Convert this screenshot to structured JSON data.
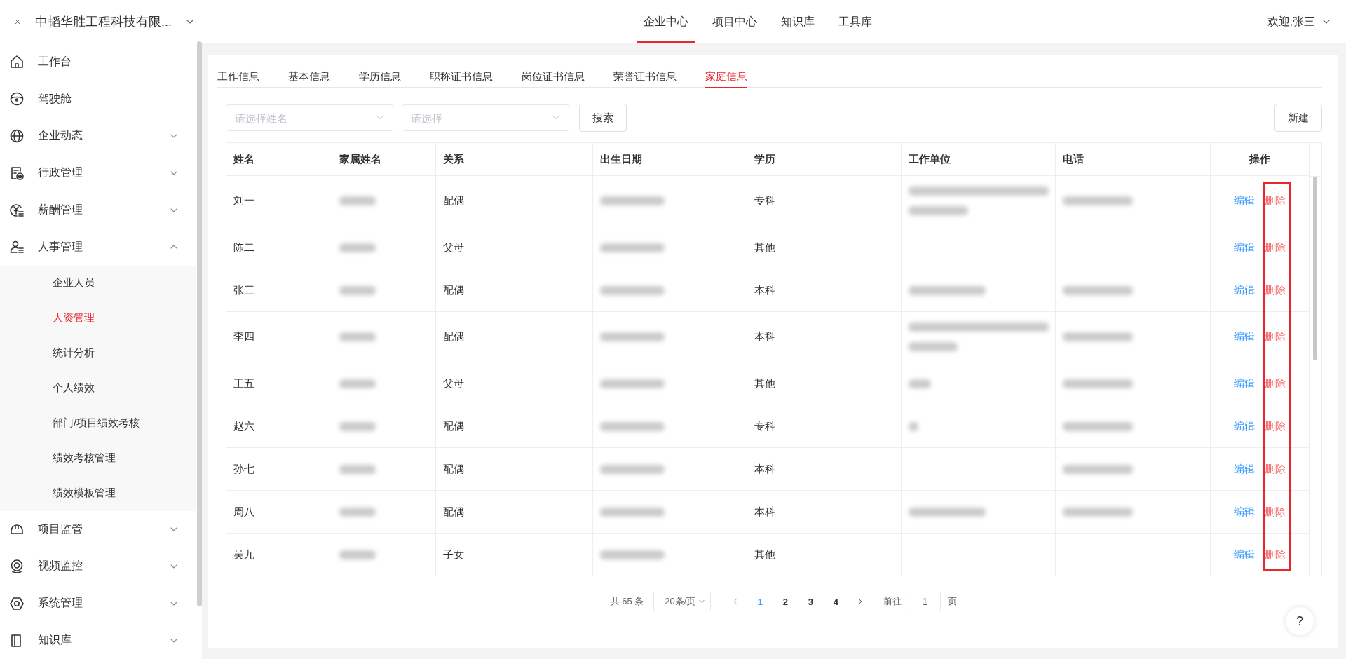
{
  "header": {
    "company": "中韬华胜工程科技有限...",
    "nav": [
      {
        "label": "企业中心",
        "selected": true
      },
      {
        "label": "项目中心",
        "selected": false
      },
      {
        "label": "知识库",
        "selected": false
      },
      {
        "label": "工具库",
        "selected": false
      }
    ],
    "welcome": "欢迎,张三"
  },
  "sidebar": {
    "items": [
      {
        "label": "工作台",
        "selected": false
      },
      {
        "label": "驾驶舱",
        "selected": false
      },
      {
        "label": "企业动态",
        "selected": false,
        "expanded": false
      },
      {
        "label": "行政管理",
        "selected": false,
        "expanded": false
      },
      {
        "label": "薪酬管理",
        "selected": false,
        "expanded": false
      },
      {
        "label": "人事管理",
        "selected": false,
        "expanded": true,
        "children": [
          {
            "label": "企业人员",
            "selected": false
          },
          {
            "label": "人资管理",
            "selected": true
          },
          {
            "label": "统计分析",
            "selected": false
          },
          {
            "label": "个人绩效",
            "selected": false
          },
          {
            "label": "部门/项目绩效考核",
            "selected": false
          },
          {
            "label": "绩效考核管理",
            "selected": false
          },
          {
            "label": "绩效模板管理",
            "selected": false
          }
        ]
      },
      {
        "label": "项目监管",
        "selected": false,
        "expanded": false
      },
      {
        "label": "视频监控",
        "selected": false,
        "expanded": false
      },
      {
        "label": "系统管理",
        "selected": false,
        "expanded": false
      },
      {
        "label": "知识库",
        "selected": false,
        "expanded": false
      }
    ]
  },
  "tabs": [
    {
      "label": "工作信息",
      "selected": false
    },
    {
      "label": "基本信息",
      "selected": false
    },
    {
      "label": "学历信息",
      "selected": false
    },
    {
      "label": "职称证书信息",
      "selected": false
    },
    {
      "label": "岗位证书信息",
      "selected": false
    },
    {
      "label": "荣誉证书信息",
      "selected": false
    },
    {
      "label": "家庭信息",
      "selected": true
    }
  ],
  "filters": [
    {
      "placeholder": "请选择姓名"
    },
    {
      "placeholder": "请选择"
    }
  ],
  "search_button": "搜索",
  "new_button": "新建",
  "table": {
    "columns": [
      "姓名",
      "家属姓名",
      "关系",
      "出生日期",
      "学历",
      "工作单位",
      "电话",
      "操作"
    ],
    "rows": [
      {
        "name": "刘一",
        "relative_blurred": true,
        "relation": "配偶",
        "birth_blurred": true,
        "education": "专科",
        "work_unit_blurred": true,
        "phone_blurred": true,
        "actions": [
          "编辑",
          "删除"
        ]
      },
      {
        "name": "陈二",
        "relative_blurred": true,
        "relation": "父母",
        "birth_blurred": true,
        "education": "其他",
        "work_unit_blurred": false,
        "phone_blurred": false,
        "actions": [
          "编辑",
          "删除"
        ]
      },
      {
        "name": "张三",
        "relative_blurred": true,
        "relation": "配偶",
        "birth_blurred": true,
        "education": "本科",
        "work_unit_blurred": true,
        "phone_blurred": true,
        "actions": [
          "编辑",
          "删除"
        ]
      },
      {
        "name": "李四",
        "relative_blurred": true,
        "relation": "配偶",
        "birth_blurred": true,
        "education": "本科",
        "work_unit_blurred": true,
        "phone_blurred": true,
        "actions": [
          "编辑",
          "删除"
        ]
      },
      {
        "name": "王五",
        "relative_blurred": true,
        "relation": "父母",
        "birth_blurred": true,
        "education": "其他",
        "work_unit_blurred": true,
        "phone_blurred": true,
        "actions": [
          "编辑",
          "删除"
        ]
      },
      {
        "name": "赵六",
        "relative_blurred": true,
        "relation": "配偶",
        "birth_blurred": true,
        "education": "专科",
        "work_unit_blurred": true,
        "phone_blurred": true,
        "actions": [
          "编辑",
          "删除"
        ]
      },
      {
        "name": "孙七",
        "relative_blurred": true,
        "relation": "配偶",
        "birth_blurred": true,
        "education": "本科",
        "work_unit_blurred": false,
        "phone_blurred": true,
        "actions": [
          "编辑",
          "删除"
        ]
      },
      {
        "name": "周八",
        "relative_blurred": true,
        "relation": "配偶",
        "birth_blurred": true,
        "education": "本科",
        "work_unit_blurred": true,
        "phone_blurred": true,
        "actions": [
          "编辑",
          "删除"
        ]
      },
      {
        "name": "吴九",
        "relative_blurred": true,
        "relation": "子女",
        "birth_blurred": true,
        "education": "其他",
        "work_unit_blurred": false,
        "phone_blurred": false,
        "actions": [
          "编辑",
          "删除"
        ]
      }
    ]
  },
  "annotation": {
    "kind": "highlight-box"
  },
  "pagination": {
    "total": "共 65 条",
    "page_size": "20条/页",
    "pages": [
      {
        "label": "1",
        "selected": true
      },
      {
        "label": "2",
        "selected": false
      },
      {
        "label": "3",
        "selected": false
      },
      {
        "label": "4",
        "selected": false
      }
    ],
    "goto_label": "前往",
    "goto_value": "1",
    "goto_suffix": "页"
  },
  "help_button": "?"
}
